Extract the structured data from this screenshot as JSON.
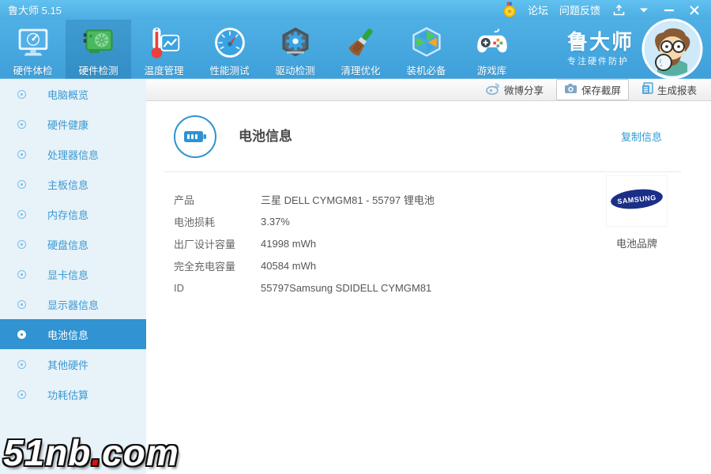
{
  "titlebar": {
    "title": "鲁大师 5.15",
    "forum": "论坛",
    "feedback": "问题反馈"
  },
  "toolbar": {
    "items": [
      {
        "label": "硬件体检"
      },
      {
        "label": "硬件检测"
      },
      {
        "label": "温度管理"
      },
      {
        "label": "性能测试"
      },
      {
        "label": "驱动检测"
      },
      {
        "label": "清理优化"
      },
      {
        "label": "装机必备"
      },
      {
        "label": "游戏库"
      }
    ],
    "active_index": 1,
    "logo_name": "鲁大师",
    "logo_slogan": "专注硬件防护"
  },
  "actionbar": {
    "weibo_share": "微博分享",
    "save_screenshot": "保存截屏",
    "generate_report": "生成报表"
  },
  "sidebar": {
    "items": [
      {
        "label": "电脑概览"
      },
      {
        "label": "硬件健康"
      },
      {
        "label": "处理器信息"
      },
      {
        "label": "主板信息"
      },
      {
        "label": "内存信息"
      },
      {
        "label": "硬盘信息"
      },
      {
        "label": "显卡信息"
      },
      {
        "label": "显示器信息"
      },
      {
        "label": "电池信息"
      },
      {
        "label": "其他硬件"
      },
      {
        "label": "功耗估算"
      }
    ],
    "active_index": 8
  },
  "content": {
    "title": "电池信息",
    "copy_link": "复制信息",
    "rows": [
      {
        "label": "产品",
        "value": "三星 DELL CYMGM81 - 55797 锂电池"
      },
      {
        "label": "电池损耗",
        "value": "3.37%"
      },
      {
        "label": "出厂设计容量",
        "value": "41998 mWh"
      },
      {
        "label": "完全充电容量",
        "value": "40584 mWh"
      },
      {
        "label": "ID",
        "value": "55797Samsung SDIDELL CYMGM81"
      }
    ],
    "brand_logo_text": "SAMSUNG",
    "brand_label": "电池品牌"
  },
  "watermark": {
    "part1": "51nb",
    "dot": ".",
    "part2": "com"
  },
  "colors": {
    "titlebar_blue": "#4cade2",
    "toolbar_blue": "#3f9fd9",
    "sidebar_bg": "#e8f2f9",
    "selected_blue": "#3193d1",
    "link_blue": "#2e9bd6",
    "samsung_navy": "#1c2f87",
    "accent": "#2f93d0"
  }
}
